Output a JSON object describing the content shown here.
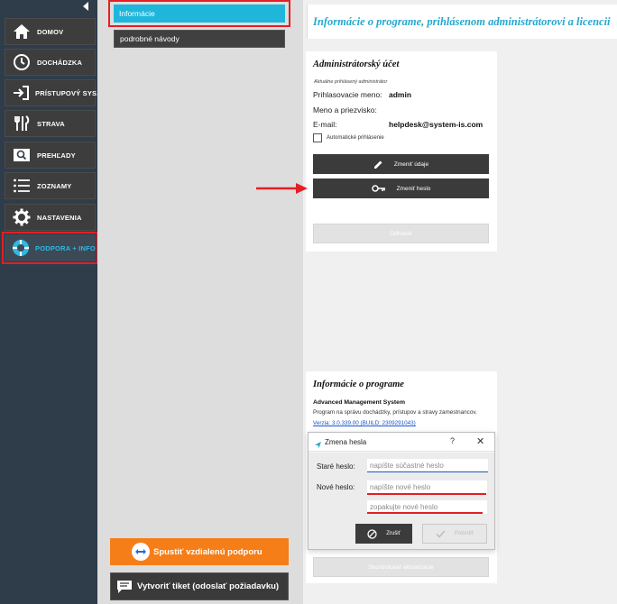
{
  "nav": {
    "items": [
      {
        "label": "DOMOV",
        "icon": "home-icon"
      },
      {
        "label": "DOCHÁDZKA",
        "icon": "clock-icon"
      },
      {
        "label": "PRÍSTUPOVÝ SYS.",
        "icon": "login-icon"
      },
      {
        "label": "STRAVA",
        "icon": "cutlery-icon"
      },
      {
        "label": "PREHĽADY",
        "icon": "search-icon"
      },
      {
        "label": "ZOZNAMY",
        "icon": "list-icon"
      },
      {
        "label": "NASTAVENIA",
        "icon": "gear-icon"
      },
      {
        "label": "PODPORA + INFO",
        "icon": "lifebuoy-icon",
        "active": true
      }
    ]
  },
  "submenu": {
    "items": [
      {
        "label": "Informácie",
        "active": true
      },
      {
        "label": "podrobné návody"
      }
    ],
    "remote_support_label": "Spustiť vzdialenú podporu",
    "ticket_label": "Vytvoriť tiket (odoslať požiadavku)"
  },
  "header": {
    "title": "Informácie o programe, prihlásenom administrátorovi a licencii"
  },
  "admin_card": {
    "title": "Administrátorský účet",
    "subtitle": "Aktuálne prihlásený administrátor",
    "login_label": "Prihlasovacie meno:",
    "login_value": "admin",
    "name_label": "Meno a priezvisko:",
    "name_value": "",
    "email_label": "E-mail:",
    "email_value": "helpdesk@system-is.com",
    "auto_login_label": "Automatické prihlásenie",
    "auto_login_checked": false,
    "change_data_label": "Zmeniť údaje",
    "change_password_label": "Zmeniť heslo",
    "logout_label": "Odhlásiť"
  },
  "program_card": {
    "title": "Informácie o programe",
    "product_name": "Advanced Management System",
    "description": "Program na správu dochádzky, prístupov a stravy zamestnancov.",
    "version": "Verzia: 3.0.339.00 (BUILD: 2309291043)",
    "check_updates_label": "Skontrolovať aktualizácie"
  },
  "dialog": {
    "title": "Zmena hesla",
    "help": "?",
    "close": "✕",
    "old_label": "Staré heslo:",
    "old_placeholder": "napíšte súčastné heslo",
    "new_label": "Nové heslo:",
    "new_placeholder": "napíšte nové heslo",
    "repeat_placeholder": "zopakujte nové heslo",
    "cancel_label": "Zrušiť",
    "save_label": "Potvrdiť"
  },
  "colors": {
    "accent": "#1fb6dc",
    "highlight": "#e41e25",
    "nav_bg": "#2f3d4a",
    "orange": "#f57e18"
  }
}
